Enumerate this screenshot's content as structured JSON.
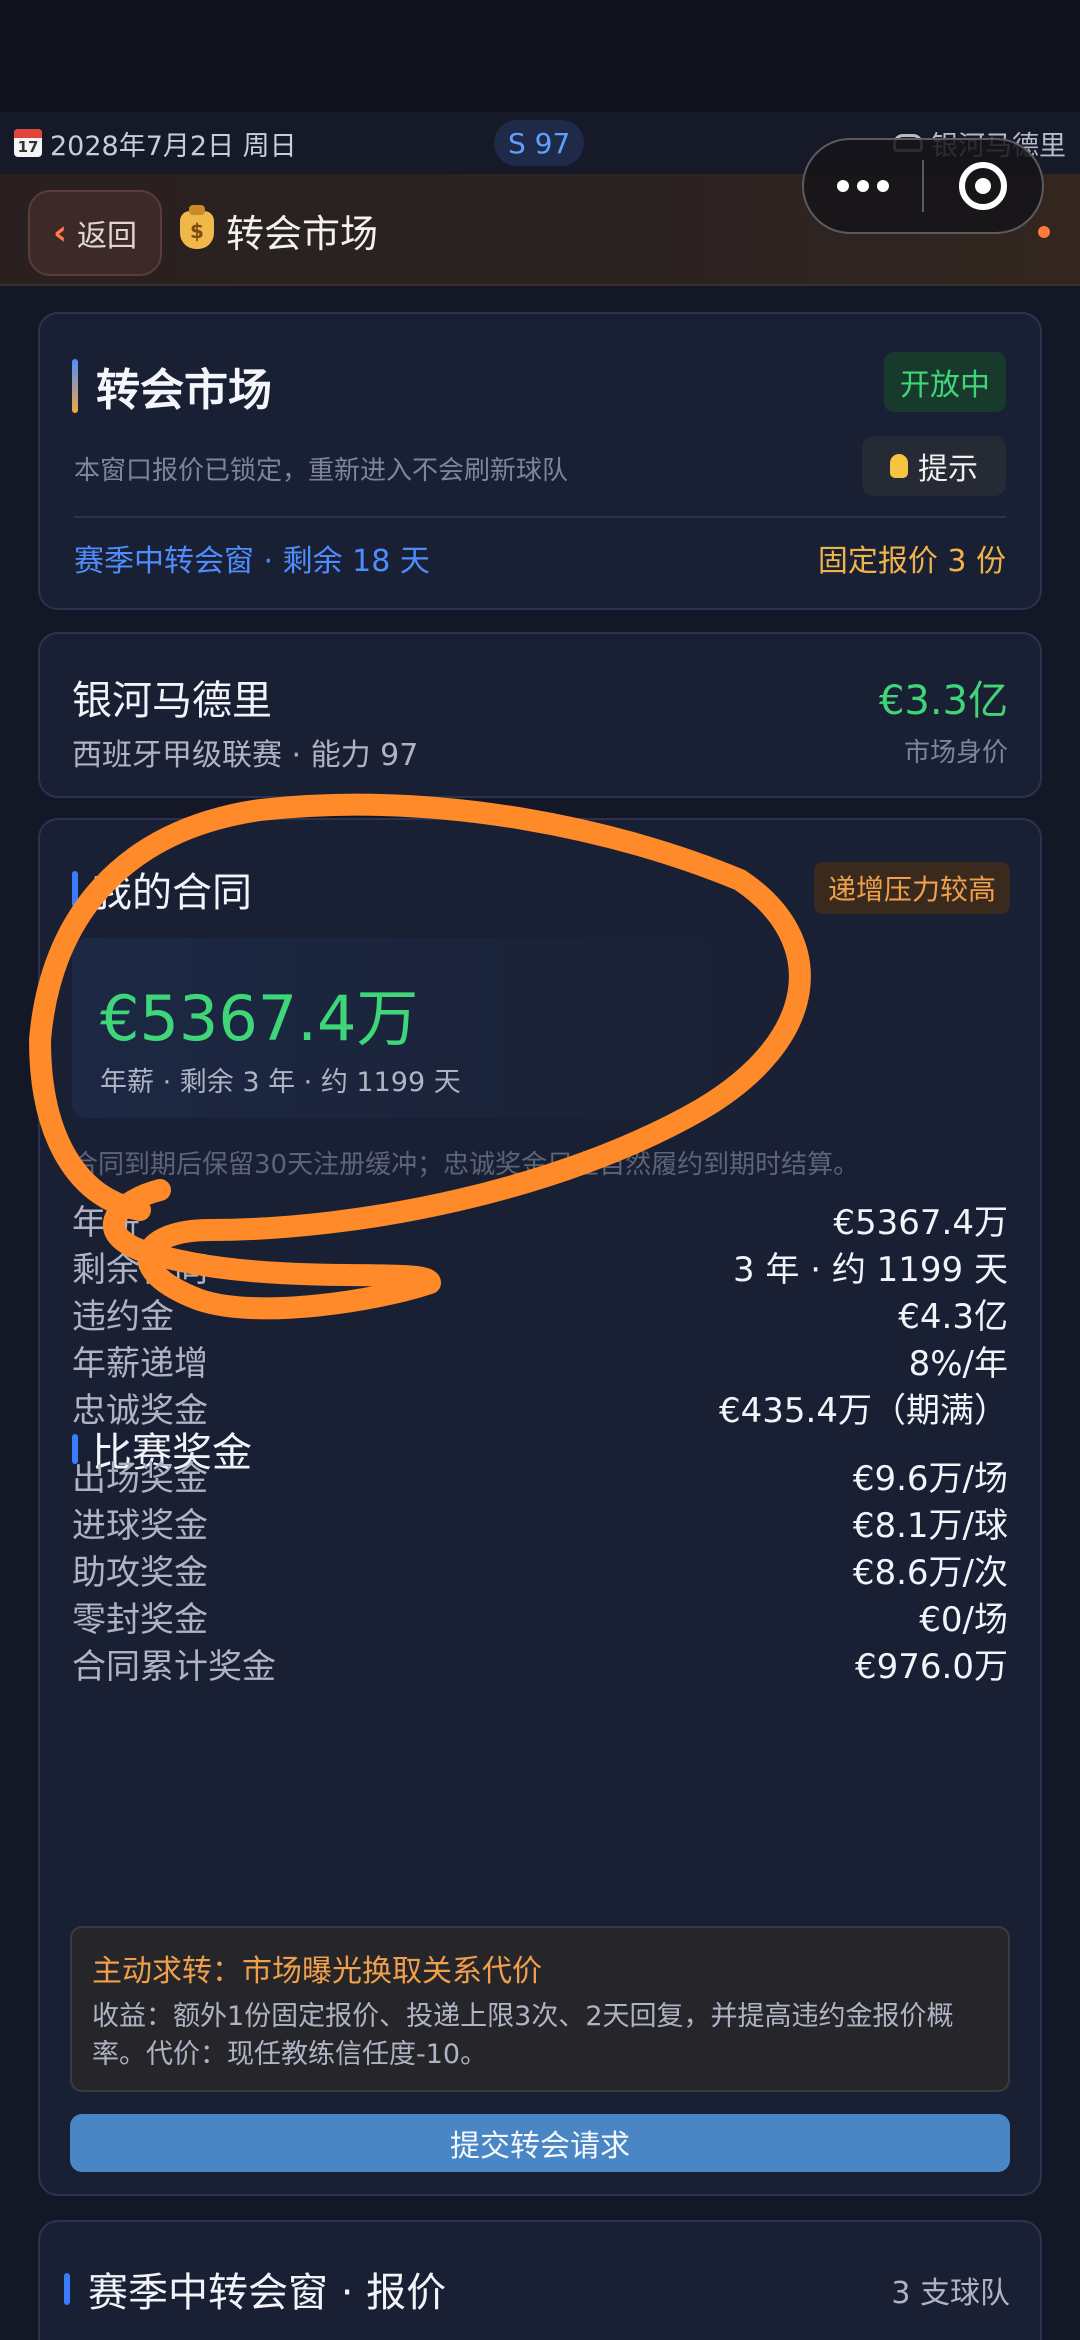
{
  "status": {
    "calendar_day": "17",
    "date": "2028年7月2日 周日",
    "season": "S 97",
    "team": "银河马德里"
  },
  "nav": {
    "back_label": "返回",
    "title": "转会市场"
  },
  "market": {
    "title": "转会市场",
    "state": "开放中",
    "note": "本窗口报价已锁定，重新进入不会刷新球队",
    "hint_label": "提示",
    "window": "赛季中转会窗 · 剩余 18 天",
    "fixed_quotes": "固定报价 3 份"
  },
  "club": {
    "name": "银河马德里",
    "meta": "西班牙甲级联赛 · 能力 97",
    "value": "€3.3亿",
    "value_label": "市场身价"
  },
  "contract": {
    "title": "我的合同",
    "pressure_badge": "递增压力较高",
    "salary": "€5367.4万",
    "salary_sub": "年薪 · 剩余 3 年 · 约 1199 天",
    "grace_note": "合同到期后保留30天注册缓冲；忠诚奖金只在自然履约到期时结算。",
    "rows": [
      {
        "k": "年薪",
        "v": "€5367.4万"
      },
      {
        "k": "剩余合同",
        "v": "3 年 · 约 1199 天"
      },
      {
        "k": "违约金",
        "v": "€4.3亿"
      },
      {
        "k": "年薪递增",
        "v": "8%/年"
      },
      {
        "k": "忠诚奖金",
        "v": "€435.4万（期满）"
      }
    ]
  },
  "bonus": {
    "title": "比赛奖金",
    "rows": [
      {
        "k": "出场奖金",
        "v": "€9.6万/场"
      },
      {
        "k": "进球奖金",
        "v": "€8.1万/球"
      },
      {
        "k": "助攻奖金",
        "v": "€8.6万/次"
      },
      {
        "k": "零封奖金",
        "v": "€0/场"
      },
      {
        "k": "合同累计奖金",
        "v": "€976.0万"
      }
    ]
  },
  "transfer_request": {
    "title": "主动求转：市场曝光换取关系代价",
    "desc": "收益：额外1份固定报价、投递上限3次、2天回复，并提高违约金报价概率。代价：现任教练信任度-10。",
    "button": "提交转会请求"
  },
  "offers": {
    "title": "赛季中转会窗 · 报价",
    "count": "3 支球队"
  }
}
